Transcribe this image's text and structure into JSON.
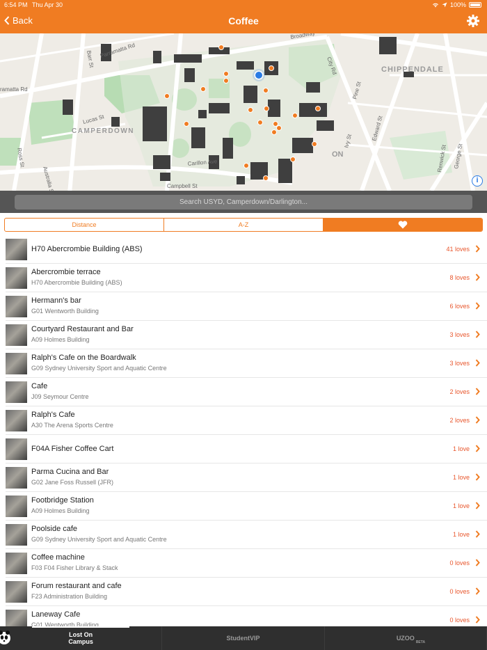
{
  "status": {
    "time": "6:54 PM",
    "date": "Thu Apr 30",
    "battery": "100%"
  },
  "nav": {
    "back_label": "Back",
    "title": "Coffee"
  },
  "map": {
    "labels": {
      "parramatta_rd_left": "ramatta Rd",
      "parramatta_rd_top": "Parramatta Rd",
      "barr_st": "Barr St",
      "lucas_st": "Lucas St",
      "camperdown": "CAMPERDOWN",
      "ross_st": "Ross St",
      "australia_st": "Australia St",
      "carillon_ave": "Carillon Ave",
      "campbell_st": "Campbell St",
      "broadway": "Broadway",
      "chippendale": "CHIPPENDALE",
      "city_rd": "City Rd",
      "pine_st": "Pine St",
      "edward_st": "Edward St",
      "ivy_st": "Ivy St",
      "renwick_st": "Renwick St",
      "george_st": "George St",
      "darlington_partial": "ON"
    },
    "info_label": "i"
  },
  "search": {
    "placeholder": "Search USYD, Camperdown/Darlington..."
  },
  "segments": [
    "Distance",
    "A-Z"
  ],
  "items": [
    {
      "title": "H70 Abercrombie Building (ABS)",
      "subtitle": "",
      "loves": "41 loves"
    },
    {
      "title": "Abercrombie terrace",
      "subtitle": "H70 Abercrombie Building (ABS)",
      "loves": "8 loves"
    },
    {
      "title": "Hermann's bar",
      "subtitle": "G01 Wentworth Building",
      "loves": "6 loves"
    },
    {
      "title": "Courtyard Restaurant and Bar",
      "subtitle": "A09 Holmes Building",
      "loves": "3 loves"
    },
    {
      "title": "Ralph's Cafe on the Boardwalk",
      "subtitle": "G09 Sydney University Sport and Aquatic Centre",
      "loves": "3 loves"
    },
    {
      "title": "Cafe",
      "subtitle": "J09 Seymour Centre",
      "loves": "2 loves"
    },
    {
      "title": "Ralph's Cafe",
      "subtitle": "A30 The Arena Sports Centre",
      "loves": "2 loves"
    },
    {
      "title": "F04A Fisher Coffee Cart",
      "subtitle": "",
      "loves": "1 love"
    },
    {
      "title": "Parma Cucina and Bar",
      "subtitle": "G02 Jane Foss Russell (JFR)",
      "loves": "1 love"
    },
    {
      "title": "Footbridge Station",
      "subtitle": "A09 Holmes Building",
      "loves": "1 love"
    },
    {
      "title": "Poolside cafe",
      "subtitle": "G09 Sydney University Sport and Aquatic Centre",
      "loves": "1 love"
    },
    {
      "title": "Coffee machine",
      "subtitle": "F03 F04 Fisher Library & Stack",
      "loves": "0 loves"
    },
    {
      "title": "Forum restaurant and cafe",
      "subtitle": "F23 Administration Building",
      "loves": "0 loves"
    },
    {
      "title": "Laneway Cafe",
      "subtitle": "G01 Wentworth Building",
      "loves": "0 loves"
    }
  ],
  "tabs": [
    {
      "label_line1": "Lost On",
      "label_line2": "Campus",
      "active": true
    },
    {
      "label_line1": "StudentVIP",
      "label_line2": "",
      "active": false
    },
    {
      "label_line1": "UZOO",
      "label_line2": "",
      "badge": "BETA",
      "active": false
    }
  ],
  "colors": {
    "accent": "#f07c22",
    "loves": "#e8562c",
    "tabbar": "#2f2f2f"
  }
}
